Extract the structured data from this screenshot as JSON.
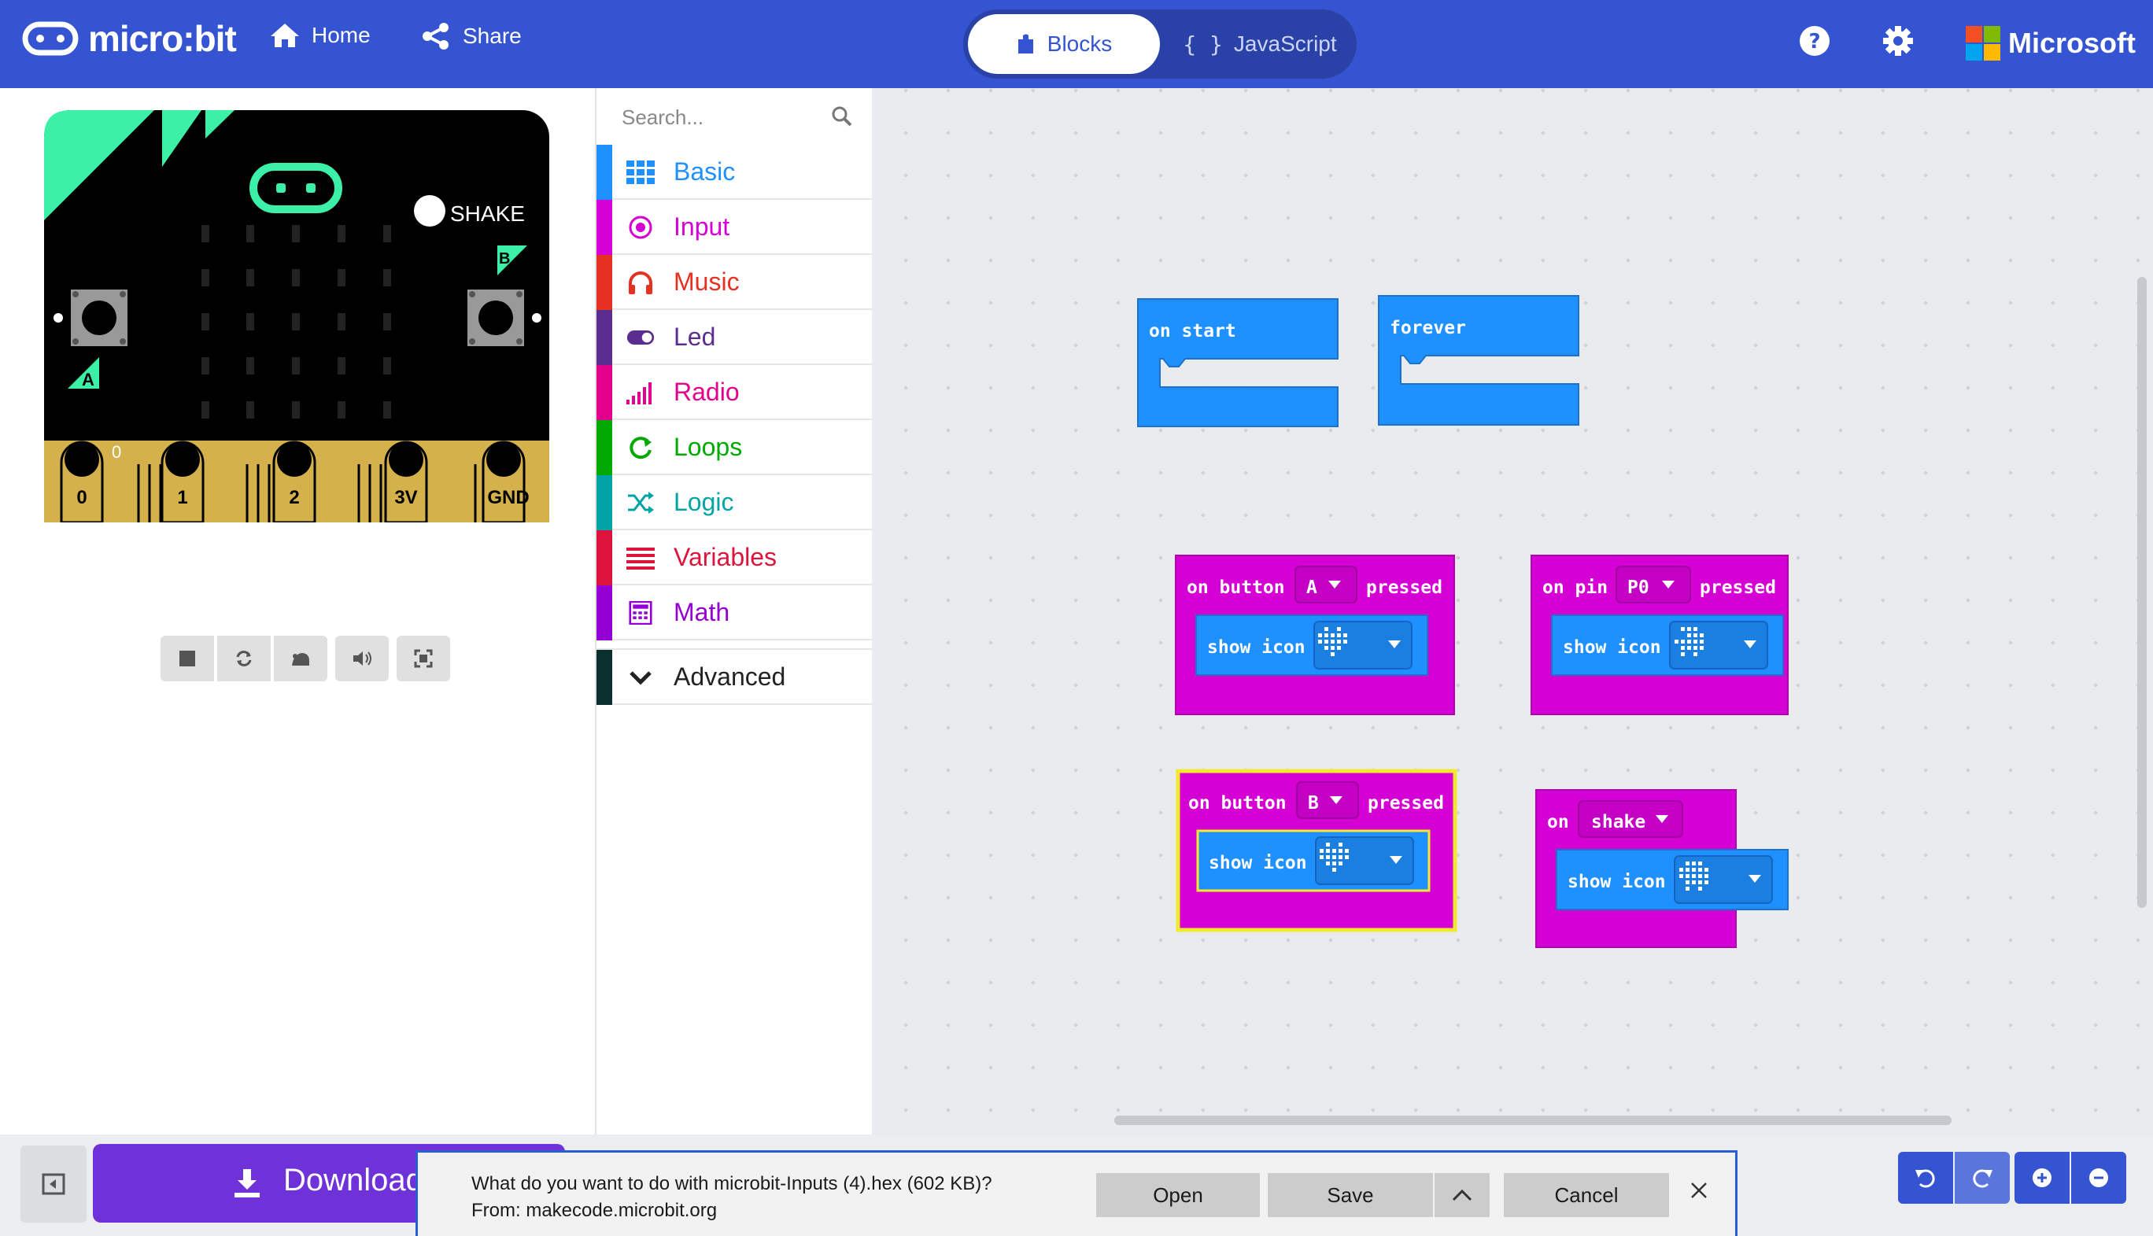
{
  "header": {
    "brand": "micro:bit",
    "nav": [
      {
        "label": "Home"
      },
      {
        "label": "Share"
      }
    ],
    "toggle": {
      "blocks": "Blocks",
      "javascript": "JavaScript"
    },
    "microsoft": "Microsoft"
  },
  "simulator": {
    "shake_label": "SHAKE",
    "button_a": "A",
    "button_b": "B",
    "pin_value": "0",
    "pins": [
      "0",
      "1",
      "2",
      "3V",
      "GND"
    ]
  },
  "toolbox": {
    "search_placeholder": "Search...",
    "categories": [
      {
        "label": "Basic",
        "color": "#1e90ff"
      },
      {
        "label": "Input",
        "color": "#d400d4"
      },
      {
        "label": "Music",
        "color": "#e63022"
      },
      {
        "label": "Led",
        "color": "#5c2d91"
      },
      {
        "label": "Radio",
        "color": "#e3008c"
      },
      {
        "label": "Loops",
        "color": "#00aa00"
      },
      {
        "label": "Logic",
        "color": "#00a4a6"
      },
      {
        "label": "Variables",
        "color": "#dc143c"
      },
      {
        "label": "Math",
        "color": "#9400d3"
      }
    ],
    "advanced": "Advanced"
  },
  "blocks": {
    "on_start": "on start",
    "forever": "forever",
    "on_button_a": {
      "prefix": "on button",
      "value": "A",
      "suffix": "pressed"
    },
    "on_pin": {
      "prefix": "on pin",
      "value": "P0",
      "suffix": "pressed"
    },
    "on_button_b": {
      "prefix": "on button",
      "value": "B",
      "suffix": "pressed"
    },
    "on_shake": {
      "prefix": "on",
      "value": "shake"
    },
    "show_icon": "show icon"
  },
  "bottom": {
    "download": "Download"
  },
  "dialog": {
    "question": "What do you want to do with microbit-Inputs (4).hex (602 KB)?",
    "source": "From: makecode.microbit.org",
    "open": "Open",
    "save": "Save",
    "cancel": "Cancel"
  }
}
